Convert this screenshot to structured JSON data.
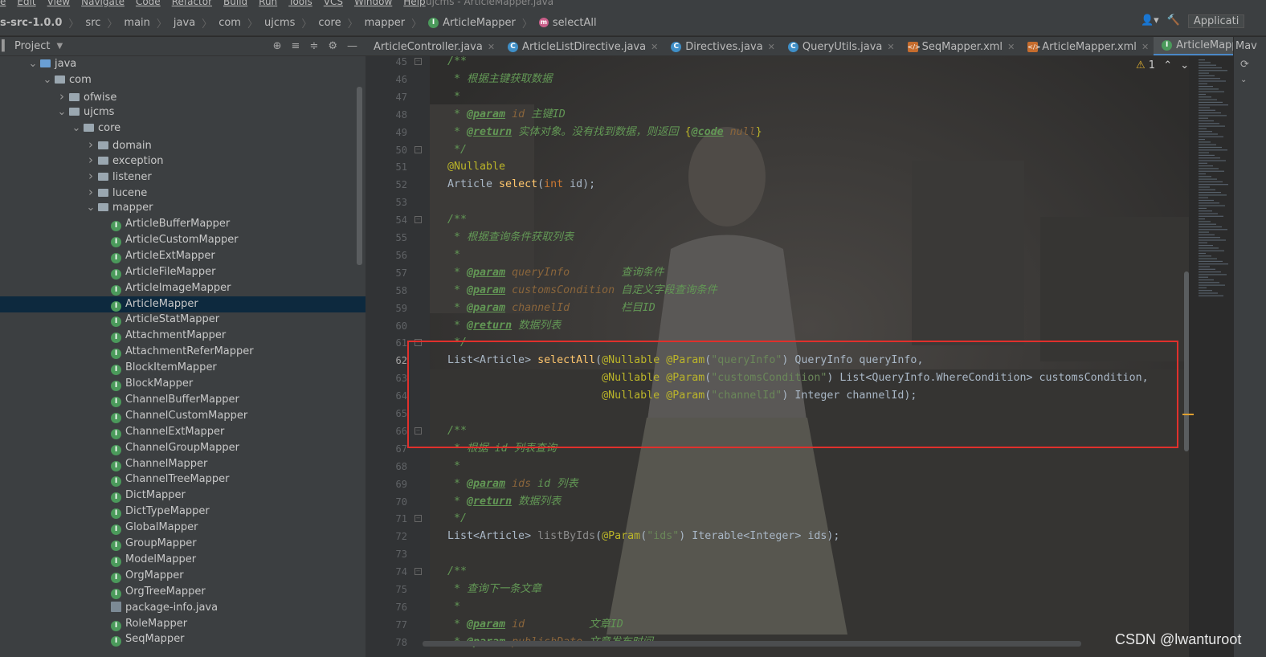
{
  "menu": {
    "items": [
      "e",
      "Edit",
      "View",
      "Navigate",
      "Code",
      "Refactor",
      "Build",
      "Run",
      "Tools",
      "VCS",
      "Window",
      "Help"
    ],
    "title": "ujcms - ArticleMapper.java"
  },
  "breadcrumb": [
    "s-src-1.0.0",
    "src",
    "main",
    "java",
    "com",
    "ujcms",
    "core",
    "mapper",
    "ArticleMapper",
    "selectAll"
  ],
  "run_config": "Applicati",
  "project_panel": {
    "title": "Project"
  },
  "tree": [
    {
      "label": "java",
      "depth": 1,
      "kind": "folder-blue",
      "chev": "down"
    },
    {
      "label": "com",
      "depth": 2,
      "kind": "folder",
      "chev": "down"
    },
    {
      "label": "ofwise",
      "depth": 3,
      "kind": "folder",
      "chev": "right"
    },
    {
      "label": "ujcms",
      "depth": 3,
      "kind": "folder",
      "chev": "down"
    },
    {
      "label": "core",
      "depth": 4,
      "kind": "folder",
      "chev": "down"
    },
    {
      "label": "domain",
      "depth": 5,
      "kind": "folder",
      "chev": "right"
    },
    {
      "label": "exception",
      "depth": 5,
      "kind": "folder",
      "chev": "right"
    },
    {
      "label": "listener",
      "depth": 5,
      "kind": "folder",
      "chev": "right"
    },
    {
      "label": "lucene",
      "depth": 5,
      "kind": "folder",
      "chev": "right"
    },
    {
      "label": "mapper",
      "depth": 5,
      "kind": "folder",
      "chev": "down"
    },
    {
      "label": "ArticleBufferMapper",
      "depth": 6,
      "kind": "iface"
    },
    {
      "label": "ArticleCustomMapper",
      "depth": 6,
      "kind": "iface"
    },
    {
      "label": "ArticleExtMapper",
      "depth": 6,
      "kind": "iface"
    },
    {
      "label": "ArticleFileMapper",
      "depth": 6,
      "kind": "iface"
    },
    {
      "label": "ArticleImageMapper",
      "depth": 6,
      "kind": "iface"
    },
    {
      "label": "ArticleMapper",
      "depth": 6,
      "kind": "iface",
      "selected": true
    },
    {
      "label": "ArticleStatMapper",
      "depth": 6,
      "kind": "iface"
    },
    {
      "label": "AttachmentMapper",
      "depth": 6,
      "kind": "iface"
    },
    {
      "label": "AttachmentReferMapper",
      "depth": 6,
      "kind": "iface"
    },
    {
      "label": "BlockItemMapper",
      "depth": 6,
      "kind": "iface"
    },
    {
      "label": "BlockMapper",
      "depth": 6,
      "kind": "iface"
    },
    {
      "label": "ChannelBufferMapper",
      "depth": 6,
      "kind": "iface"
    },
    {
      "label": "ChannelCustomMapper",
      "depth": 6,
      "kind": "iface"
    },
    {
      "label": "ChannelExtMapper",
      "depth": 6,
      "kind": "iface"
    },
    {
      "label": "ChannelGroupMapper",
      "depth": 6,
      "kind": "iface"
    },
    {
      "label": "ChannelMapper",
      "depth": 6,
      "kind": "iface"
    },
    {
      "label": "ChannelTreeMapper",
      "depth": 6,
      "kind": "iface"
    },
    {
      "label": "DictMapper",
      "depth": 6,
      "kind": "iface"
    },
    {
      "label": "DictTypeMapper",
      "depth": 6,
      "kind": "iface"
    },
    {
      "label": "GlobalMapper",
      "depth": 6,
      "kind": "iface"
    },
    {
      "label": "GroupMapper",
      "depth": 6,
      "kind": "iface"
    },
    {
      "label": "ModelMapper",
      "depth": 6,
      "kind": "iface"
    },
    {
      "label": "OrgMapper",
      "depth": 6,
      "kind": "iface"
    },
    {
      "label": "OrgTreeMapper",
      "depth": 6,
      "kind": "iface"
    },
    {
      "label": "package-info.java",
      "depth": 6,
      "kind": "pkg"
    },
    {
      "label": "RoleMapper",
      "depth": 6,
      "kind": "iface"
    },
    {
      "label": "SeqMapper",
      "depth": 6,
      "kind": "iface"
    }
  ],
  "tabs": [
    {
      "label": "ArticleController.java",
      "icon": "none"
    },
    {
      "label": "ArticleListDirective.java",
      "icon": "class"
    },
    {
      "label": "Directives.java",
      "icon": "class"
    },
    {
      "label": "QueryUtils.java",
      "icon": "class"
    },
    {
      "label": "SeqMapper.xml",
      "icon": "xml"
    },
    {
      "label": "ArticleMapper.xml",
      "icon": "xml"
    },
    {
      "label": "ArticleMapper.java",
      "icon": "iface",
      "active": true
    }
  ],
  "right_panel_label": "Mav",
  "warning_count": "1",
  "current_line": 62,
  "code": [
    {
      "n": 45,
      "s": [
        [
          "cm",
          "/**"
        ]
      ]
    },
    {
      "n": 46,
      "s": [
        [
          "cm",
          " * 根据主键获取数据"
        ]
      ]
    },
    {
      "n": 47,
      "s": [
        [
          "cm",
          " *"
        ]
      ]
    },
    {
      "n": 48,
      "s": [
        [
          "cm",
          " * "
        ],
        [
          "tg",
          "@param"
        ],
        [
          "pn",
          " id"
        ],
        [
          "cm",
          " 主键ID"
        ]
      ]
    },
    {
      "n": 49,
      "s": [
        [
          "cm",
          " * "
        ],
        [
          "tg",
          "@return"
        ],
        [
          "cm",
          " 实体对象。没有找到数据，则返回 "
        ],
        [
          "an",
          "{"
        ],
        [
          "tg",
          "@code"
        ],
        [
          "pn",
          " null"
        ],
        [
          "an",
          "}"
        ]
      ]
    },
    {
      "n": 50,
      "s": [
        [
          "cm",
          " */"
        ]
      ]
    },
    {
      "n": 51,
      "s": [
        [
          "an",
          "@Nullable"
        ]
      ]
    },
    {
      "n": 52,
      "s": [
        [
          "ty",
          "Article "
        ],
        [
          "fn",
          "select"
        ],
        [
          "ty",
          "("
        ],
        [
          "kw",
          "int"
        ],
        [
          "ty",
          " id);"
        ]
      ]
    },
    {
      "n": 53,
      "s": [
        [
          "ty",
          ""
        ]
      ]
    },
    {
      "n": 54,
      "s": [
        [
          "cm",
          "/**"
        ]
      ]
    },
    {
      "n": 55,
      "s": [
        [
          "cm",
          " * 根据查询条件获取列表"
        ]
      ]
    },
    {
      "n": 56,
      "s": [
        [
          "cm",
          " *"
        ]
      ]
    },
    {
      "n": 57,
      "s": [
        [
          "cm",
          " * "
        ],
        [
          "tg",
          "@param"
        ],
        [
          "pn",
          " queryInfo"
        ],
        [
          "cm",
          "        查询条件"
        ]
      ]
    },
    {
      "n": 58,
      "s": [
        [
          "cm",
          " * "
        ],
        [
          "tg",
          "@param"
        ],
        [
          "pn",
          " customsCondition"
        ],
        [
          "cm",
          " 自定义字段查询条件"
        ]
      ]
    },
    {
      "n": 59,
      "s": [
        [
          "cm",
          " * "
        ],
        [
          "tg",
          "@param"
        ],
        [
          "pn",
          " channelId"
        ],
        [
          "cm",
          "        栏目ID"
        ]
      ]
    },
    {
      "n": 60,
      "s": [
        [
          "cm",
          " * "
        ],
        [
          "tg",
          "@return"
        ],
        [
          "cm",
          " 数据列表"
        ]
      ]
    },
    {
      "n": 61,
      "s": [
        [
          "cm",
          " */"
        ]
      ]
    },
    {
      "n": 62,
      "s": [
        [
          "ty",
          "List<Article> "
        ],
        [
          "fn",
          "selectAll"
        ],
        [
          "ty",
          "("
        ],
        [
          "an",
          "@Nullable @Param"
        ],
        [
          "ty",
          "("
        ],
        [
          "st",
          "\"queryInfo\""
        ],
        [
          "ty",
          ") QueryInfo queryInfo,"
        ]
      ]
    },
    {
      "n": 63,
      "s": [
        [
          "ty",
          "                        "
        ],
        [
          "an",
          "@Nullable @Param"
        ],
        [
          "ty",
          "("
        ],
        [
          "st",
          "\"customsCondition\""
        ],
        [
          "ty",
          ") List<QueryInfo.WhereCondition> customsCondition,"
        ]
      ]
    },
    {
      "n": 64,
      "s": [
        [
          "ty",
          "                        "
        ],
        [
          "an",
          "@Nullable @Param"
        ],
        [
          "ty",
          "("
        ],
        [
          "st",
          "\"channelId\""
        ],
        [
          "ty",
          ") Integer channelId);"
        ]
      ]
    },
    {
      "n": 65,
      "s": [
        [
          "ty",
          ""
        ]
      ]
    },
    {
      "n": 66,
      "s": [
        [
          "cm",
          "/**"
        ]
      ]
    },
    {
      "n": 67,
      "s": [
        [
          "cm",
          " * 根据 id 列表查询"
        ]
      ]
    },
    {
      "n": 68,
      "s": [
        [
          "cm",
          " *"
        ]
      ]
    },
    {
      "n": 69,
      "s": [
        [
          "cm",
          " * "
        ],
        [
          "tg",
          "@param"
        ],
        [
          "pn",
          " ids"
        ],
        [
          "cm",
          " id 列表"
        ]
      ]
    },
    {
      "n": 70,
      "s": [
        [
          "cm",
          " * "
        ],
        [
          "tg",
          "@return"
        ],
        [
          "cm",
          " 数据列表"
        ]
      ]
    },
    {
      "n": 71,
      "s": [
        [
          "cm",
          " */"
        ]
      ]
    },
    {
      "n": 72,
      "s": [
        [
          "ty",
          "List<Article> "
        ],
        [
          "dim",
          "listByIds"
        ],
        [
          "ty",
          "("
        ],
        [
          "an",
          "@Param"
        ],
        [
          "ty",
          "("
        ],
        [
          "st",
          "\"ids\""
        ],
        [
          "ty",
          ") Iterable<Integer> ids);"
        ]
      ]
    },
    {
      "n": 73,
      "s": [
        [
          "ty",
          ""
        ]
      ]
    },
    {
      "n": 74,
      "s": [
        [
          "cm",
          "/**"
        ]
      ]
    },
    {
      "n": 75,
      "s": [
        [
          "cm",
          " * 查询下一条文章"
        ]
      ]
    },
    {
      "n": 76,
      "s": [
        [
          "cm",
          " *"
        ]
      ]
    },
    {
      "n": 77,
      "s": [
        [
          "cm",
          " * "
        ],
        [
          "tg",
          "@param"
        ],
        [
          "pn",
          " id"
        ],
        [
          "cm",
          "          文章ID"
        ]
      ]
    },
    {
      "n": 78,
      "s": [
        [
          "cm",
          " * "
        ],
        [
          "tg",
          "@param"
        ],
        [
          "pn",
          " publishDate"
        ],
        [
          "cm",
          " 文章发布时间"
        ]
      ]
    }
  ],
  "fold_lines": [
    45,
    50,
    54,
    61,
    66,
    71,
    74
  ],
  "watermark": "CSDN @lwanturoot"
}
